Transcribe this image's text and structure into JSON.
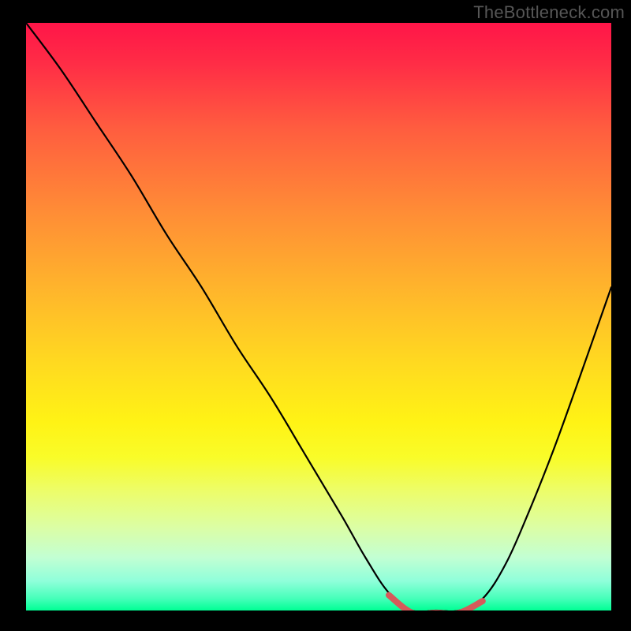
{
  "watermark": "TheBottleneck.com",
  "colors": {
    "frame": "#000000",
    "curve": "#000000",
    "marker": "#d65a5a"
  },
  "chart_data": {
    "type": "line",
    "title": "",
    "xlabel": "",
    "ylabel": "",
    "xlim": [
      0,
      100
    ],
    "ylim": [
      0,
      100
    ],
    "grid": false,
    "legend": false,
    "series": [
      {
        "name": "bottleneck-curve",
        "x": [
          0,
          6,
          12,
          18,
          24,
          30,
          36,
          42,
          48,
          54,
          58,
          62,
          66,
          70,
          74,
          78,
          82,
          86,
          90,
          94,
          100
        ],
        "y": [
          100,
          92,
          83,
          74,
          64,
          55,
          45,
          36,
          26,
          16,
          9,
          3,
          0,
          0,
          0,
          2,
          8,
          17,
          27,
          38,
          55
        ]
      }
    ],
    "highlight": {
      "name": "optimal-range",
      "x": [
        62,
        66,
        70,
        74,
        78
      ],
      "y": [
        3,
        0,
        0,
        0,
        2
      ]
    },
    "annotations": [
      {
        "text": "TheBottleneck.com",
        "role": "watermark",
        "position": "top-right"
      }
    ]
  }
}
